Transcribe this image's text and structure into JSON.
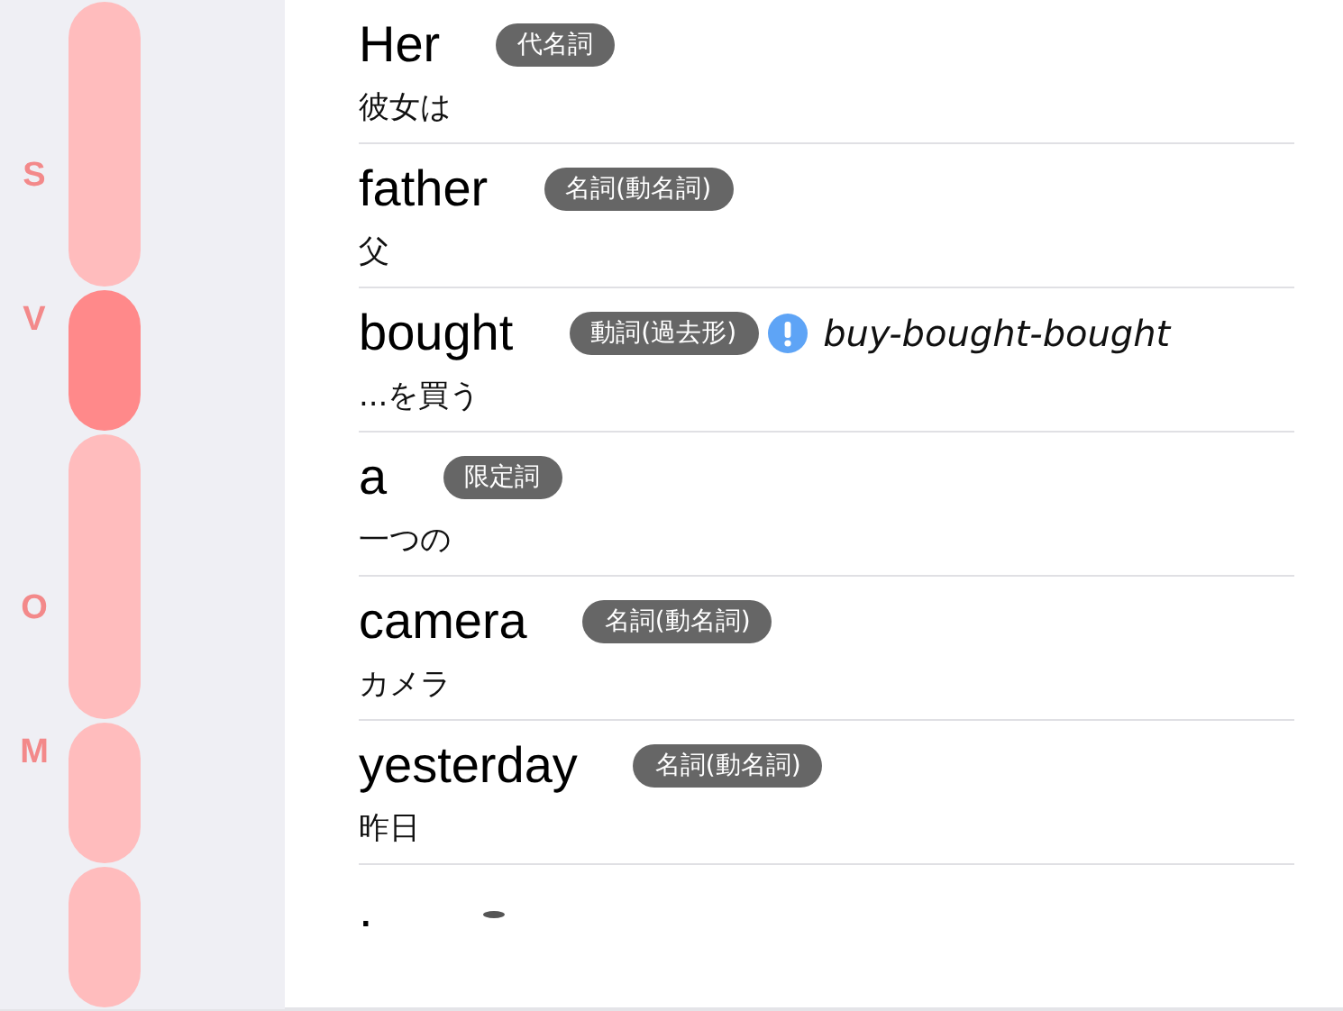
{
  "groups": [
    {
      "label": "S",
      "selected": false,
      "rows": [
        {
          "word": "Her",
          "tag": "代名詞",
          "meaning": "彼女は"
        },
        {
          "word": "father",
          "tag": "名詞(動名詞)",
          "meaning": "父"
        }
      ]
    },
    {
      "label": "V",
      "selected": true,
      "rows": [
        {
          "word": "bought",
          "tag": "動詞(過去形)",
          "meaning": "...を買う",
          "note": "buy-bought-bought"
        }
      ]
    },
    {
      "label": "O",
      "selected": false,
      "rows": [
        {
          "word": "a",
          "tag": "限定詞",
          "meaning": "一つの"
        },
        {
          "word": "camera",
          "tag": "名詞(動名詞)",
          "meaning": "カメラ"
        }
      ]
    },
    {
      "label": "M",
      "selected": false,
      "rows": [
        {
          "word": "yesterday",
          "tag": "名詞(動名詞)",
          "meaning": "昨日"
        }
      ]
    },
    {
      "selected": false,
      "rows": [
        {
          "word": ".",
          "kind": "punctuation"
        }
      ]
    }
  ]
}
